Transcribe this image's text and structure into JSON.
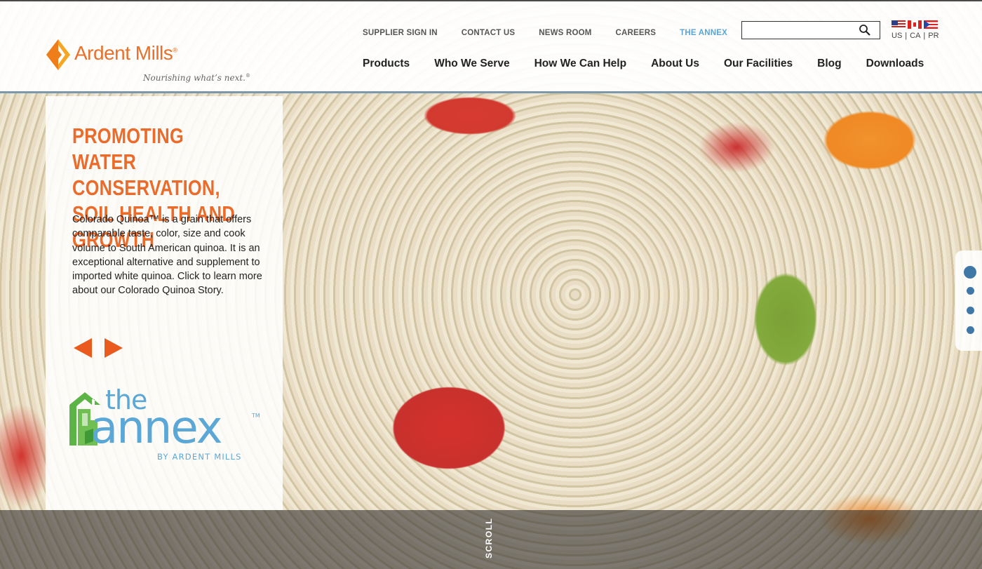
{
  "brand": {
    "name": "Ardent Mills",
    "registered": "®",
    "tagline": "Nourishing what’s next.",
    "tagline_mark": "®",
    "accent_color": "#e8702a"
  },
  "utility_nav": [
    {
      "label": "SUPPLIER SIGN IN"
    },
    {
      "label": "CONTACT US"
    },
    {
      "label": "NEWS ROOM"
    },
    {
      "label": "CAREERS"
    },
    {
      "label": "THE ANNEX"
    }
  ],
  "search": {
    "value": "",
    "placeholder": "",
    "icon": "search-icon"
  },
  "locale": {
    "flags": [
      "us-flag-icon",
      "canada-flag-icon",
      "puerto-rico-flag-icon"
    ],
    "links": [
      "US",
      "CA",
      "PR"
    ],
    "separator": "|"
  },
  "main_nav": [
    {
      "label": "Products"
    },
    {
      "label": "Who We Serve"
    },
    {
      "label": "How We Can Help"
    },
    {
      "label": "About Us"
    },
    {
      "label": "Our Facilities"
    },
    {
      "label": "Blog"
    },
    {
      "label": "Downloads"
    }
  ],
  "feature": {
    "title": "PROMOTING WATER CONSERVATION, SOIL HEALTH AND GROWTH",
    "body": "Colorado Quinoa™ is a grain that offers comparable taste, color, size and cook volume to South American quinoa. It is an exceptional alternative and supplement to imported white quinoa. Click to learn more about our Colorado Quinoa Story.",
    "prev_icon": "arrow-left-icon",
    "next_icon": "arrow-right-icon",
    "title_color": "#ea6b2a"
  },
  "annex_logo": {
    "the": "the",
    "word": "annex",
    "tm": "TM",
    "byline": "BY ARDENT MILLS",
    "color": "#5ba8d6",
    "house_color": "#5cb346"
  },
  "pager": {
    "count": 4,
    "active_index": 0,
    "color": "#3f78a6"
  },
  "scroll": {
    "label": "SCROLL"
  }
}
